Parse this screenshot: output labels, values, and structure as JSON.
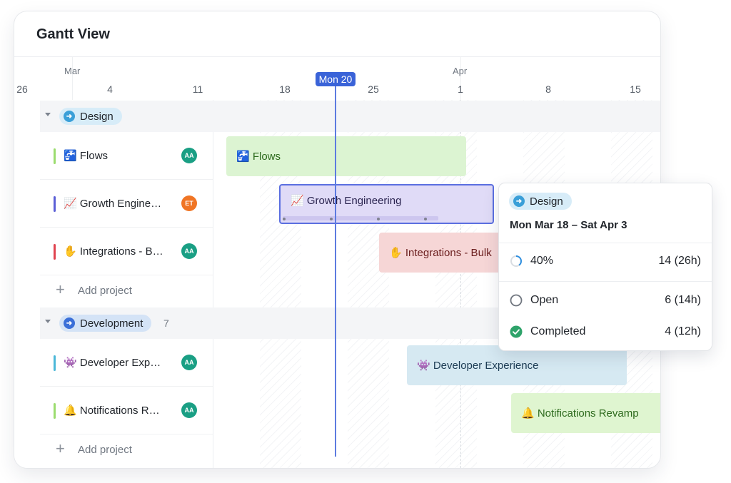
{
  "title": "Gantt View",
  "timeline": {
    "months": [
      "Mar",
      "Apr"
    ],
    "days": [
      "26",
      "4",
      "11",
      "18",
      "25",
      "1",
      "8",
      "15"
    ],
    "today_label": "Mon 20"
  },
  "groups": [
    {
      "name": "Design",
      "count": "",
      "projects": [
        {
          "icon": "🚰",
          "name": "Flows",
          "avatar": "AA",
          "color": "#9bdc6e"
        },
        {
          "icon": "📈",
          "name": "Growth Engineering",
          "avatar": "ET",
          "color": "#5b5fd6"
        },
        {
          "icon": "✋",
          "name": "Integrations - Bulk",
          "avatar": "AA",
          "color": "#e0434f"
        }
      ],
      "add_label": "Add project"
    },
    {
      "name": "Development",
      "count": "7",
      "projects": [
        {
          "icon": "👾",
          "name": "Developer Experience",
          "avatar": "AA",
          "color": "#4bb8d8"
        },
        {
          "icon": "🔔",
          "name": "Notifications Revamp",
          "avatar": "AA",
          "color": "#9bdc6e"
        }
      ],
      "add_label": "Add project"
    }
  ],
  "bars": {
    "flows": "🚰 Flows",
    "growth": "📈 Growth Engineering",
    "integrations": "✋ Integrations - Bulk",
    "devexp": "👾 Developer Experience",
    "notifications": "🔔 Notifications Revamp"
  },
  "popover": {
    "group": "Design",
    "dates": "Mon Mar 18 – Sat Apr 3",
    "progress_label": "40%",
    "progress_value": "14 (26h)",
    "progress_fraction": 0.4,
    "rows": [
      {
        "label": "Open",
        "value": "6 (14h)",
        "icon": "open-circle-icon"
      },
      {
        "label": "Completed",
        "value": "4 (12h)",
        "icon": "check-circle-icon"
      }
    ]
  },
  "colors": {
    "accent": "#3a63d8",
    "design_pill": "#d7ecf8",
    "dev_pill": "#d4e3f6",
    "avatar_aa": "#1a9f84",
    "avatar_et": "#f07524",
    "flows_bar": "#dcf4d2",
    "growth_bar": "#e0dbf7",
    "integrations_bar": "#f6d6d6",
    "devexp_bar": "#d6e9f2",
    "notifications_bar": "#dff5d0"
  }
}
